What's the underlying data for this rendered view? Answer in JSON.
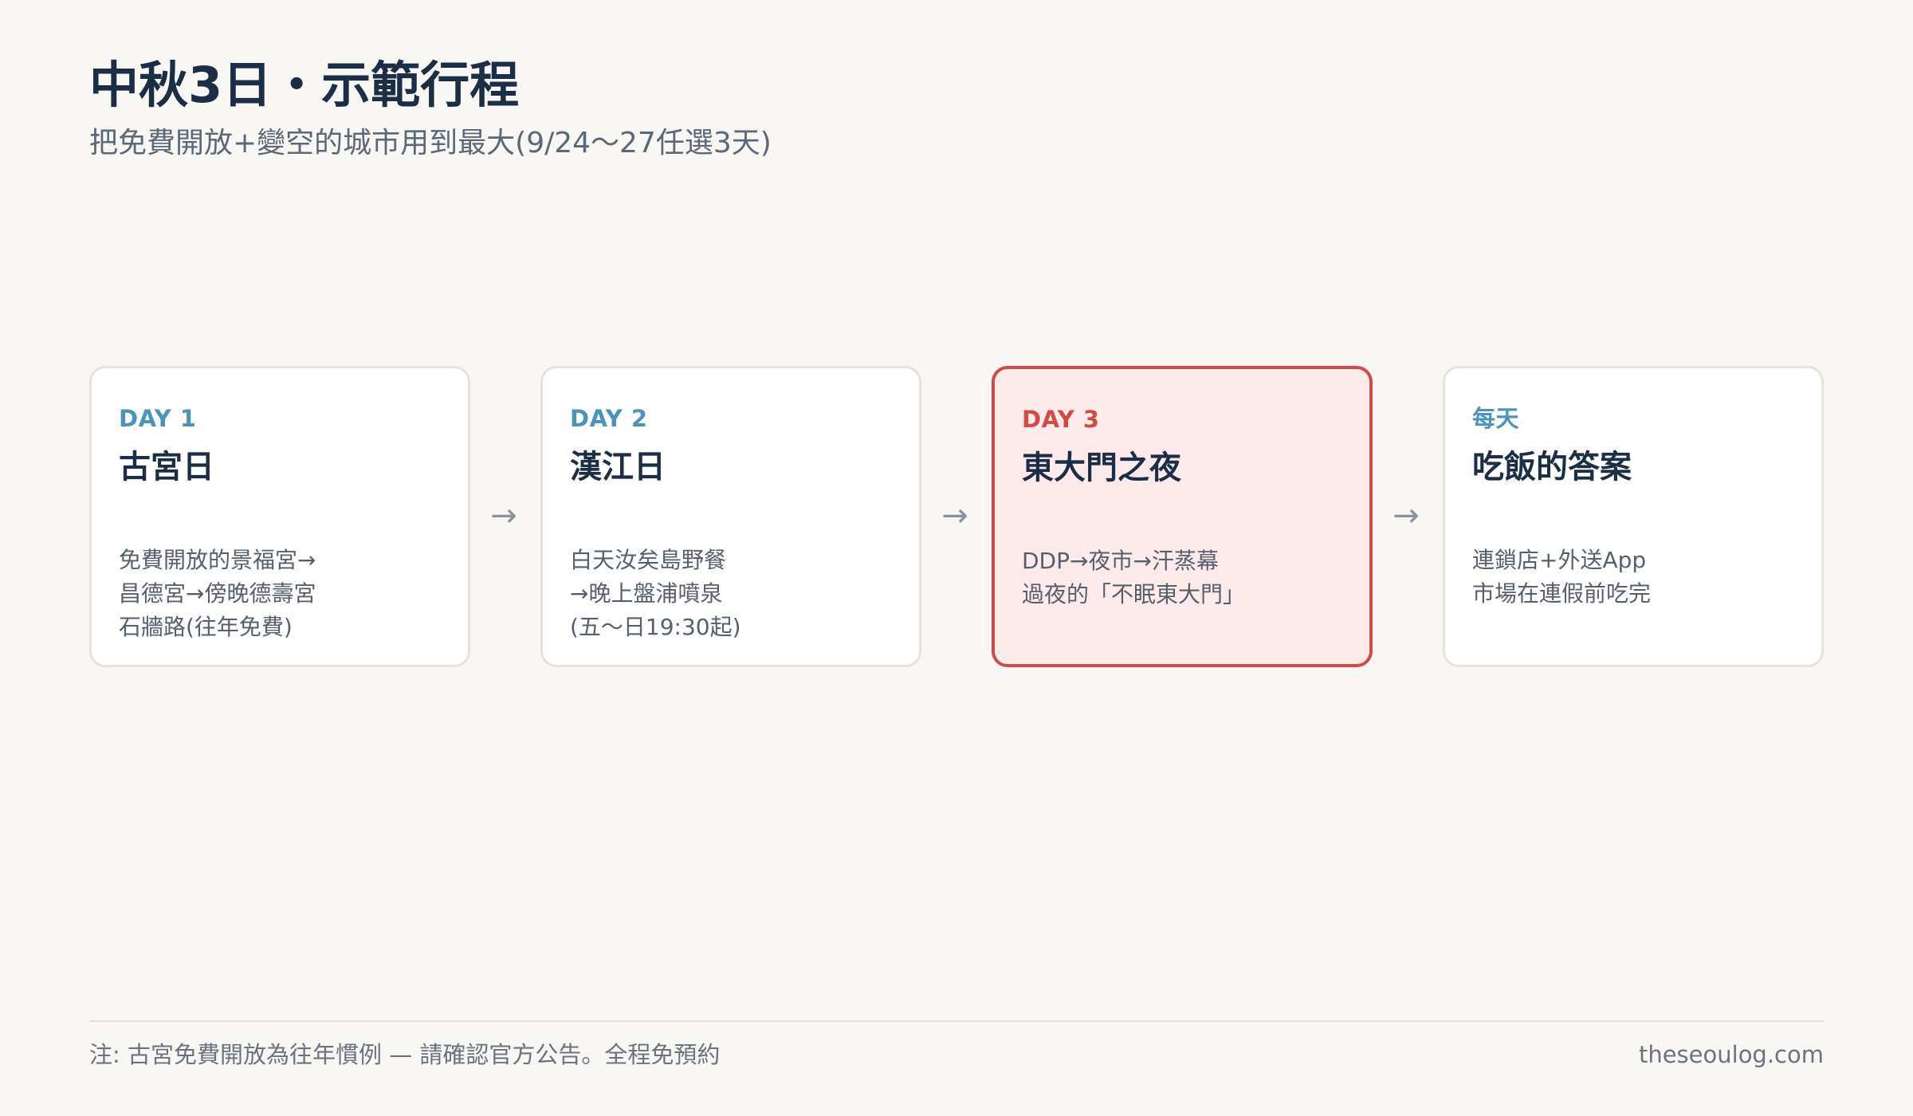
{
  "header": {
    "title": "中秋3日・示範行程",
    "subtitle": "把免費開放+變空的城市用到最大(9/24〜27任選3天)"
  },
  "cards": [
    {
      "tag": "DAY 1",
      "title": "古宮日",
      "lines": [
        "免費開放的景福宮→",
        "昌德宮→傍晚德壽宮",
        "石牆路(往年免費)"
      ]
    },
    {
      "tag": "DAY 2",
      "title": "漢江日",
      "lines": [
        "白天汝矣島野餐",
        "→晚上盤浦噴泉",
        "(五〜日19:30起)"
      ]
    },
    {
      "tag": "DAY 3",
      "title": "東大門之夜",
      "lines": [
        "DDP→夜市→汗蒸幕",
        "過夜的「不眠東大門」"
      ]
    },
    {
      "tag": "每天",
      "title": "吃飯的答案",
      "lines": [
        "連鎖店+外送App",
        "市場在連假前吃完"
      ]
    }
  ],
  "arrows": [
    "→",
    "→",
    "→"
  ],
  "footer": {
    "note": "注: 古宮免費開放為往年慣例 — 請確認官方公告。全程免預約",
    "site": "theseoulog.com"
  },
  "colors": {
    "background": "#f9f7f4",
    "title": "#1b2e45",
    "accent_blue": "#4a94bc",
    "accent_red": "#d24a44",
    "highlight_fill": "#fdeaea"
  }
}
